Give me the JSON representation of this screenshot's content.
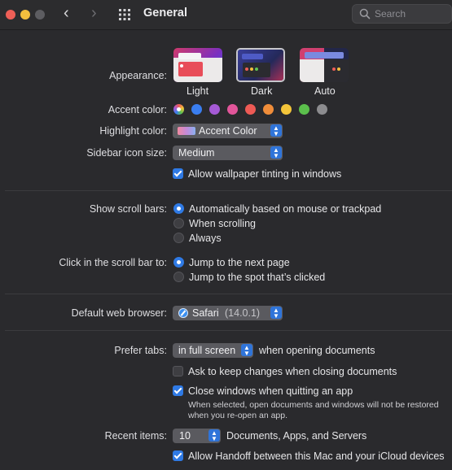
{
  "window": {
    "title": "General",
    "search_placeholder": "Search"
  },
  "appearance": {
    "label": "Appearance:",
    "options": [
      "Light",
      "Dark",
      "Auto"
    ],
    "selected": "Dark"
  },
  "accent": {
    "label": "Accent color:",
    "colors": [
      "multicolor",
      "#3a7ef0",
      "#a55ad6",
      "#e2559a",
      "#ee5a55",
      "#f08d3a",
      "#f4c53a",
      "#5bbf4c",
      "#8c8c8f"
    ]
  },
  "highlight": {
    "label": "Highlight color:",
    "value": "Accent Color"
  },
  "sidebar_icon": {
    "label": "Sidebar icon size:",
    "value": "Medium"
  },
  "wallpaper_tint": {
    "label": "Allow wallpaper tinting in windows",
    "checked": true
  },
  "scroll_bars": {
    "label": "Show scroll bars:",
    "options": [
      "Automatically based on mouse or trackpad",
      "When scrolling",
      "Always"
    ],
    "selected": 0
  },
  "scroll_click": {
    "label": "Click in the scroll bar to:",
    "options": [
      "Jump to the next page",
      "Jump to the spot that’s clicked"
    ],
    "selected": 0
  },
  "browser": {
    "label": "Default web browser:",
    "value": "Safari",
    "version": "(14.0.1)"
  },
  "tabs": {
    "label": "Prefer tabs:",
    "value": "in full screen",
    "suffix": "when opening documents"
  },
  "ask_keep": {
    "label": "Ask to keep changes when closing documents",
    "checked": false
  },
  "close_windows": {
    "label": "Close windows when quitting an app",
    "checked": true,
    "note_line1": "When selected, open documents and windows will not be restored",
    "note_line2": "when you re-open an app."
  },
  "recent": {
    "label": "Recent items:",
    "value": "10",
    "suffix": "Documents, Apps, and Servers"
  },
  "handoff": {
    "label": "Allow Handoff between this Mac and your iCloud devices",
    "checked": true
  }
}
